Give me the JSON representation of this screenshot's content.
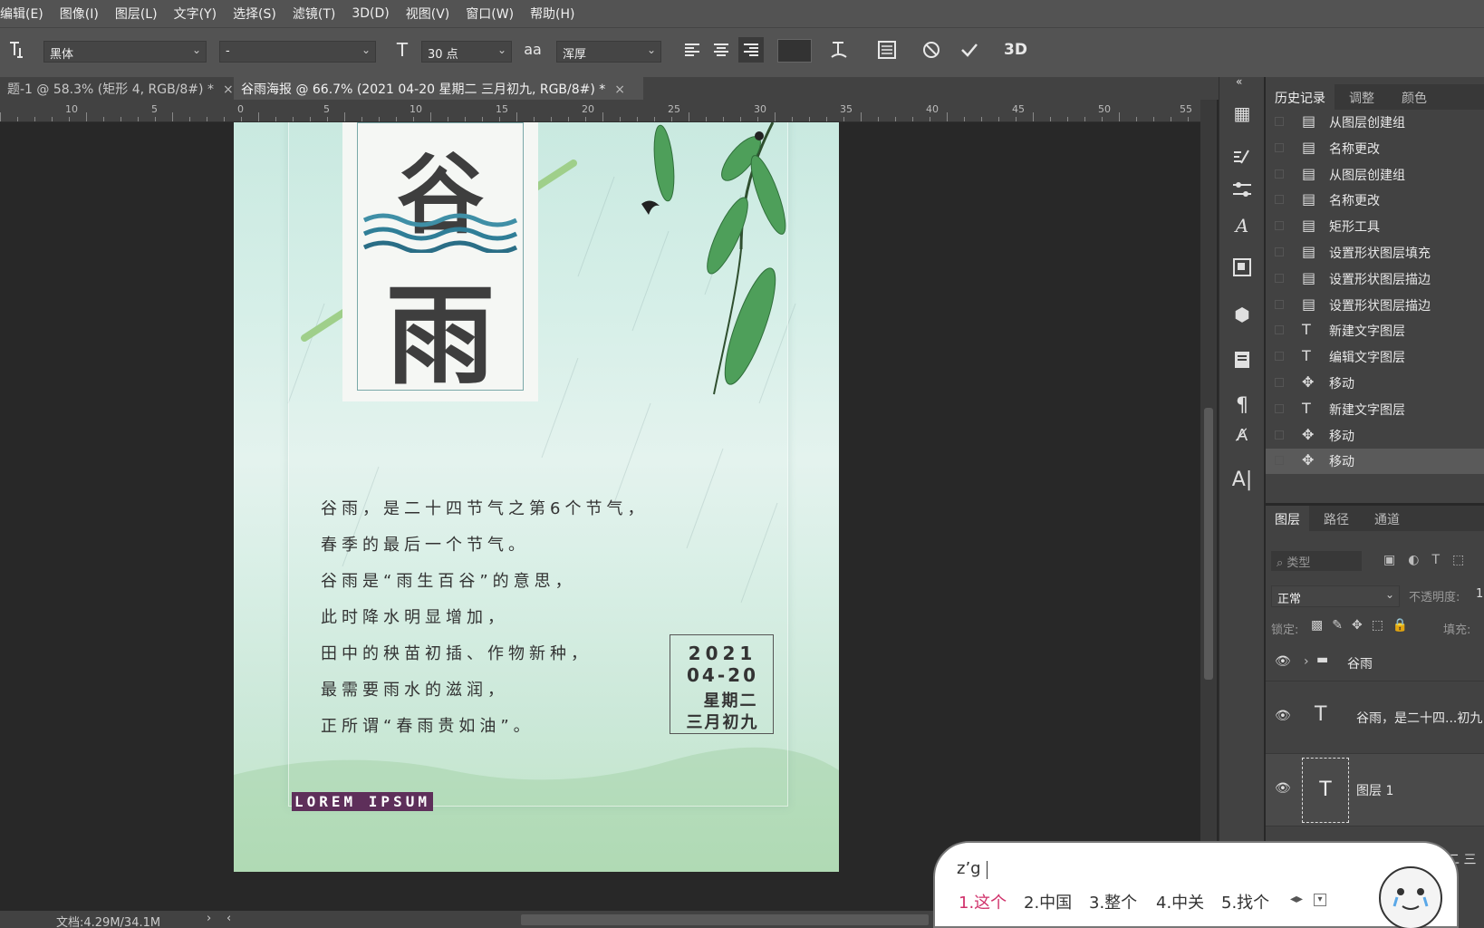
{
  "menu": [
    "编辑(E)",
    "图像(I)",
    "图层(L)",
    "文字(Y)",
    "选择(S)",
    "滤镜(T)",
    "3D(D)",
    "视图(V)",
    "窗口(W)",
    "帮助(H)"
  ],
  "options": {
    "font_family": "黑体",
    "font_style": "-",
    "font_size": "30 点",
    "antialias_icon": "aa",
    "antialias": "浑厚",
    "three_d": "3D"
  },
  "tabs": [
    {
      "label": "题-1 @ 58.3% (矩形 4, RGB/8#) *",
      "close": "×"
    },
    {
      "label": "谷雨海报 @ 66.7% (2021 04-20 星期二 三月初九, RGB/8#) *",
      "close": "×"
    }
  ],
  "ruler": {
    "left_labels": [
      "10",
      "5"
    ],
    "labels": [
      "0",
      "5",
      "10",
      "15",
      "20",
      "25",
      "30",
      "35",
      "40",
      "45",
      "50",
      "55"
    ]
  },
  "poster": {
    "char1": "谷",
    "char2": "雨",
    "body_lines": [
      "谷雨，是二十四节气之第6个节气，",
      "春季的最后一个节气。",
      "谷雨是“雨生百谷”的意思，",
      "此时降水明显增加，",
      "田中的秧苗初插、作物新种，",
      "最需要雨水的滋润，",
      "正所谓“春雨贵如油”。"
    ],
    "date": {
      "year": "2021",
      "md": "04-20",
      "weekday": "星期二",
      "lunar": "三月初九"
    },
    "lorem": "LOREM IPSUM"
  },
  "history": {
    "tabs": [
      "历史记录",
      "调整",
      "颜色"
    ],
    "items": [
      {
        "icon": "doc-icon",
        "label": "从图层创建组"
      },
      {
        "icon": "doc-icon",
        "label": "名称更改"
      },
      {
        "icon": "doc-icon",
        "label": "从图层创建组"
      },
      {
        "icon": "doc-icon",
        "label": "名称更改"
      },
      {
        "icon": "doc-icon",
        "label": "矩形工具"
      },
      {
        "icon": "doc-icon",
        "label": "设置形状图层填充"
      },
      {
        "icon": "doc-icon",
        "label": "设置形状图层描边"
      },
      {
        "icon": "doc-icon",
        "label": "设置形状图层描边"
      },
      {
        "icon": "type-icon",
        "label": "新建文字图层"
      },
      {
        "icon": "type-icon",
        "label": "编辑文字图层"
      },
      {
        "icon": "move-icon",
        "label": "移动"
      },
      {
        "icon": "type-icon",
        "label": "新建文字图层"
      },
      {
        "icon": "move-icon",
        "label": "移动"
      },
      {
        "icon": "move-icon",
        "label": "移动"
      }
    ]
  },
  "layers": {
    "tabs": [
      "图层",
      "路径",
      "通道"
    ],
    "search_placeholder": "类型",
    "blend_mode": "正常",
    "opacity_label": "不透明度:",
    "opacity_value": "1",
    "lock_label": "锁定:",
    "fill_label": "填充:",
    "items": [
      {
        "type": "group",
        "name": "谷雨"
      },
      {
        "type": "text",
        "name": "谷雨，是二十四...初九"
      },
      {
        "type": "text",
        "name": "图层 1"
      }
    ],
    "partial_text": "二 三"
  },
  "status": {
    "doc": "文档:4.29M/34.1M"
  },
  "ime": {
    "composition": "z’g",
    "candidates": [
      "1.这个",
      "2.中国",
      "3.整个",
      "4.中关",
      "5.找个"
    ]
  },
  "colors": {
    "accent": "#d0306a",
    "panel": "#424242",
    "menubar": "#535353"
  }
}
